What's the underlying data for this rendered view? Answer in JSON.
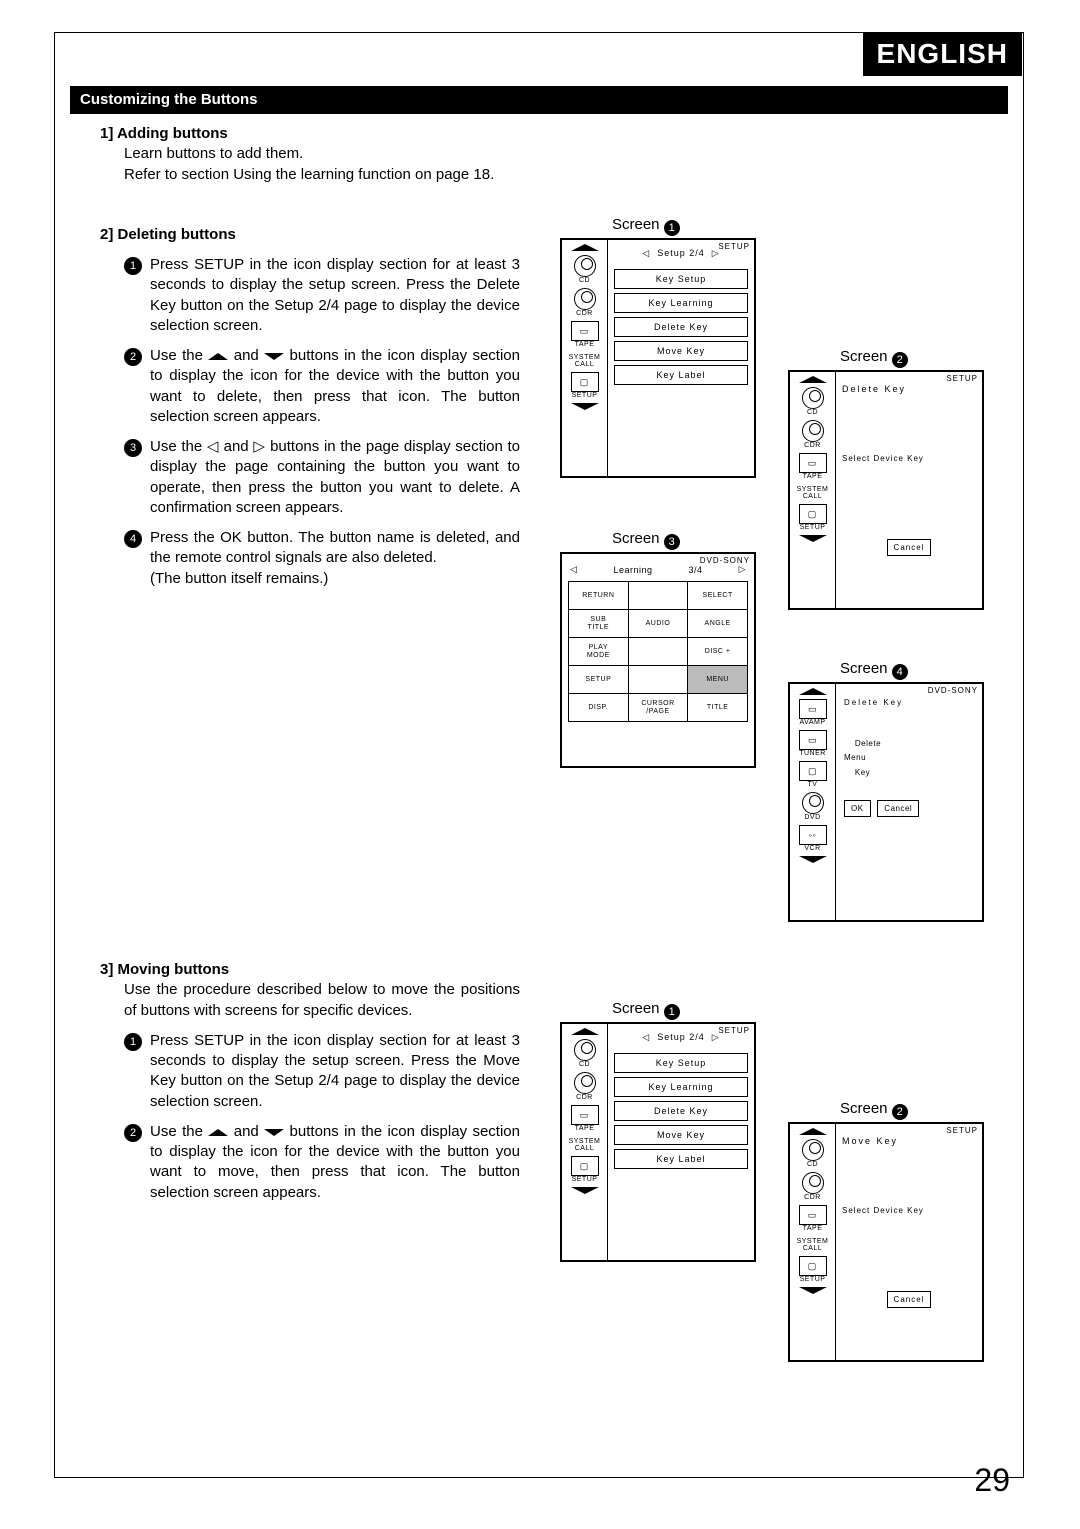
{
  "language_tab": "ENGLISH",
  "section_title": "Customizing the Buttons",
  "page_number": "29",
  "s1": {
    "heading": "1]  Adding buttons",
    "line1": "Learn  buttons to add them.",
    "line2": "Refer to section  Using the learning function  on page 18."
  },
  "s2": {
    "heading": "2]  Deleting buttons",
    "step1": "Press  SETUP  in the icon display section for at least 3 seconds to display the setup screen. Press the  Delete Key  button on the  Setup 2/4  page to display the device selection screen.",
    "step2a": "Use  the  ",
    "step2b": "  and  ",
    "step2c": "  buttons in the icon display section to display the icon for the device with the button you want to delete, then press that icon.  The button selection screen appears.",
    "step3": "Use the  ◁  and  ▷  buttons in the page display section to display the page containing the button you want to operate, then press the button you want to delete.  A confirmation screen appears.",
    "step4a": "Press  the   OK   button.   The  button  name  is deleted, and the remote control signals are also deleted.",
    "step4b": "(The button itself remains.)"
  },
  "s3": {
    "heading": "3]  Moving buttons",
    "intro": "Use the procedure described below to move the positions of buttons with screens for specific devices.",
    "step1": "Press  SETUP  in the icon display section for at least 3 seconds to display the setup screen. Press the  Move Key  button on the  Setup 2/4  page to display the device selection screen.",
    "step2a": "Use  the  ",
    "step2b": "  and  ",
    "step2c": "  buttons in the icon display section to display the icon for the device with the button you want to move, then press that icon.  The button selection screen appears."
  },
  "labels": {
    "screen": "Screen ",
    "setup_corner": "SETUP",
    "dvd_sony": "DVD-SONY",
    "setup24": "Setup 2/4",
    "key_setup": "Key Setup",
    "key_learning": "Key Learning",
    "delete_key": "Delete Key",
    "move_key": "Move Key",
    "key_label": "Key Label",
    "select_device": "Select Device Key",
    "cancel": "Cancel",
    "learning": "Learning",
    "pg34": "3/4",
    "delete": "Delete",
    "menu": "Menu",
    "key": "Key",
    "ok": "OK"
  },
  "side_icons": {
    "cd": "CD",
    "cdr": "CDR",
    "tape": "TAPE",
    "system_call": "SYSTEM\nCALL",
    "setup": "SETUP",
    "avamp": "AVAMP",
    "tuner": "TUNER",
    "tv": "TV",
    "dvd": "DVD",
    "vcr": "VCR"
  },
  "grid": {
    "r1": [
      "RETURN",
      "",
      "SELECT"
    ],
    "r2": [
      "SUB\nTITLE",
      "AUDIO",
      "ANGLE"
    ],
    "r3": [
      "PLAY\nMODE",
      "",
      "DISC +"
    ],
    "r4": [
      "SETUP",
      "",
      "MENU"
    ],
    "r5": [
      "DISP.",
      "CURSOR\n/PAGE",
      "TITLE"
    ]
  }
}
